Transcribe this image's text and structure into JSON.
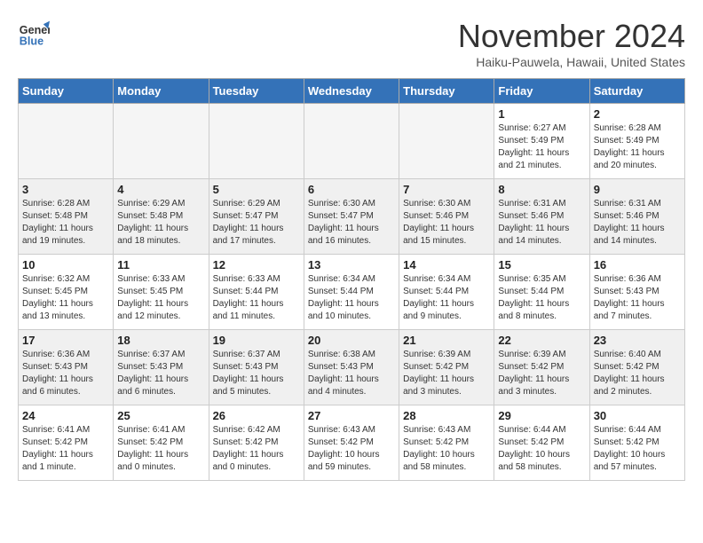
{
  "logo": {
    "line1": "General",
    "line2": "Blue"
  },
  "title": "November 2024",
  "location": "Haiku-Pauwela, Hawaii, United States",
  "weekdays": [
    "Sunday",
    "Monday",
    "Tuesday",
    "Wednesday",
    "Thursday",
    "Friday",
    "Saturday"
  ],
  "weeks": [
    [
      {
        "day": "",
        "info": ""
      },
      {
        "day": "",
        "info": ""
      },
      {
        "day": "",
        "info": ""
      },
      {
        "day": "",
        "info": ""
      },
      {
        "day": "",
        "info": ""
      },
      {
        "day": "1",
        "info": "Sunrise: 6:27 AM\nSunset: 5:49 PM\nDaylight: 11 hours and 21 minutes."
      },
      {
        "day": "2",
        "info": "Sunrise: 6:28 AM\nSunset: 5:49 PM\nDaylight: 11 hours and 20 minutes."
      }
    ],
    [
      {
        "day": "3",
        "info": "Sunrise: 6:28 AM\nSunset: 5:48 PM\nDaylight: 11 hours and 19 minutes."
      },
      {
        "day": "4",
        "info": "Sunrise: 6:29 AM\nSunset: 5:48 PM\nDaylight: 11 hours and 18 minutes."
      },
      {
        "day": "5",
        "info": "Sunrise: 6:29 AM\nSunset: 5:47 PM\nDaylight: 11 hours and 17 minutes."
      },
      {
        "day": "6",
        "info": "Sunrise: 6:30 AM\nSunset: 5:47 PM\nDaylight: 11 hours and 16 minutes."
      },
      {
        "day": "7",
        "info": "Sunrise: 6:30 AM\nSunset: 5:46 PM\nDaylight: 11 hours and 15 minutes."
      },
      {
        "day": "8",
        "info": "Sunrise: 6:31 AM\nSunset: 5:46 PM\nDaylight: 11 hours and 14 minutes."
      },
      {
        "day": "9",
        "info": "Sunrise: 6:31 AM\nSunset: 5:46 PM\nDaylight: 11 hours and 14 minutes."
      }
    ],
    [
      {
        "day": "10",
        "info": "Sunrise: 6:32 AM\nSunset: 5:45 PM\nDaylight: 11 hours and 13 minutes."
      },
      {
        "day": "11",
        "info": "Sunrise: 6:33 AM\nSunset: 5:45 PM\nDaylight: 11 hours and 12 minutes."
      },
      {
        "day": "12",
        "info": "Sunrise: 6:33 AM\nSunset: 5:44 PM\nDaylight: 11 hours and 11 minutes."
      },
      {
        "day": "13",
        "info": "Sunrise: 6:34 AM\nSunset: 5:44 PM\nDaylight: 11 hours and 10 minutes."
      },
      {
        "day": "14",
        "info": "Sunrise: 6:34 AM\nSunset: 5:44 PM\nDaylight: 11 hours and 9 minutes."
      },
      {
        "day": "15",
        "info": "Sunrise: 6:35 AM\nSunset: 5:44 PM\nDaylight: 11 hours and 8 minutes."
      },
      {
        "day": "16",
        "info": "Sunrise: 6:36 AM\nSunset: 5:43 PM\nDaylight: 11 hours and 7 minutes."
      }
    ],
    [
      {
        "day": "17",
        "info": "Sunrise: 6:36 AM\nSunset: 5:43 PM\nDaylight: 11 hours and 6 minutes."
      },
      {
        "day": "18",
        "info": "Sunrise: 6:37 AM\nSunset: 5:43 PM\nDaylight: 11 hours and 6 minutes."
      },
      {
        "day": "19",
        "info": "Sunrise: 6:37 AM\nSunset: 5:43 PM\nDaylight: 11 hours and 5 minutes."
      },
      {
        "day": "20",
        "info": "Sunrise: 6:38 AM\nSunset: 5:43 PM\nDaylight: 11 hours and 4 minutes."
      },
      {
        "day": "21",
        "info": "Sunrise: 6:39 AM\nSunset: 5:42 PM\nDaylight: 11 hours and 3 minutes."
      },
      {
        "day": "22",
        "info": "Sunrise: 6:39 AM\nSunset: 5:42 PM\nDaylight: 11 hours and 3 minutes."
      },
      {
        "day": "23",
        "info": "Sunrise: 6:40 AM\nSunset: 5:42 PM\nDaylight: 11 hours and 2 minutes."
      }
    ],
    [
      {
        "day": "24",
        "info": "Sunrise: 6:41 AM\nSunset: 5:42 PM\nDaylight: 11 hours and 1 minute."
      },
      {
        "day": "25",
        "info": "Sunrise: 6:41 AM\nSunset: 5:42 PM\nDaylight: 11 hours and 0 minutes."
      },
      {
        "day": "26",
        "info": "Sunrise: 6:42 AM\nSunset: 5:42 PM\nDaylight: 11 hours and 0 minutes."
      },
      {
        "day": "27",
        "info": "Sunrise: 6:43 AM\nSunset: 5:42 PM\nDaylight: 10 hours and 59 minutes."
      },
      {
        "day": "28",
        "info": "Sunrise: 6:43 AM\nSunset: 5:42 PM\nDaylight: 10 hours and 58 minutes."
      },
      {
        "day": "29",
        "info": "Sunrise: 6:44 AM\nSunset: 5:42 PM\nDaylight: 10 hours and 58 minutes."
      },
      {
        "day": "30",
        "info": "Sunrise: 6:44 AM\nSunset: 5:42 PM\nDaylight: 10 hours and 57 minutes."
      }
    ]
  ]
}
